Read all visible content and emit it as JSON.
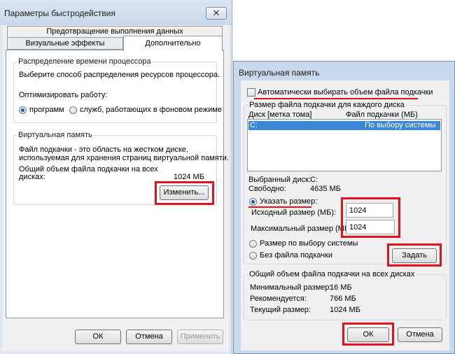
{
  "perf_window": {
    "title": "Параметры быстродействия",
    "close_glyph": "✕",
    "tab_dep": "Предотвращение выполнения данных",
    "tab_visual": "Визуальные эффекты",
    "tab_advanced": "Дополнительно",
    "cpu_group": {
      "legend": "Распределение времени процессора",
      "description": "Выберите способ распределения ресурсов процессора.",
      "optimize_label": "Оптимизировать работу:",
      "option_programs": "программ",
      "option_services": "служб, работающих в фоновом режиме"
    },
    "vm_group": {
      "legend": "Виртуальная память",
      "description_line1": "Файл подкачки - это область на жестком диске,",
      "description_line2": "используемая для хранения страниц виртуальной памяти.",
      "total_label_line1": "Общий объем файла подкачки на всех",
      "total_label_line2": "дисках:",
      "total_value": "1024 МБ",
      "change_button": "Изменить..."
    },
    "ok_button": "ОК",
    "cancel_button": "Отмена",
    "apply_button": "Применить"
  },
  "vm_window": {
    "title": "Виртуальная память",
    "auto_checkbox_label": "Автоматически выбирать объем файла подкачки",
    "auto_checked": false,
    "size_group_legend": "Размер файла подкачки для каждого диска",
    "col_disk": "Диск [метка тома]",
    "col_pagefile": "Файл подкачки (МБ)",
    "list_rows": [
      {
        "disk": "C:",
        "pagefile": "По выбору системы"
      }
    ],
    "selected_disk_label": "Выбранный диск:",
    "selected_disk_value": "C:",
    "free_label": "Свободно:",
    "free_value": "4635 МБ",
    "option_custom": "Указать размер:",
    "initial_label": "Исходный размер (МБ):",
    "initial_value": "1024",
    "max_label": "Максимальный размер (МБ):",
    "max_value": "1024",
    "option_system": "Размер по выбору системы",
    "option_none": "Без файла подкачки",
    "set_button": "Задать",
    "totals_legend": "Общий объем файла подкачки на всех дисках",
    "min_label": "Минимальный размер:",
    "min_value": "16 МБ",
    "recommended_label": "Рекомендуется:",
    "recommended_value": "766 МБ",
    "current_label": "Текущий размер:",
    "current_value": "1024 МБ",
    "ok_button": "ОК",
    "cancel_button": "Отмена"
  },
  "colors": {
    "highlight": "#e0141e",
    "selection": "#3c87d6",
    "window_frame": "#c9d9ed"
  }
}
